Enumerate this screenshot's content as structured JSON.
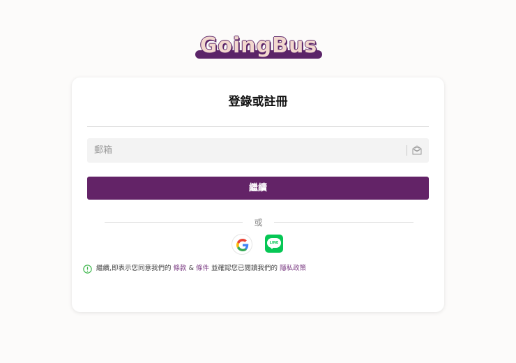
{
  "brand": {
    "logo_text": "GoingBus",
    "accent_color": "#632367",
    "logo_fill": "#f2d8ce"
  },
  "auth": {
    "title": "登錄或註冊",
    "email_placeholder": "郵箱",
    "continue_label": "繼續",
    "or_label": "或",
    "social": [
      {
        "name": "google",
        "icon": "google-icon"
      },
      {
        "name": "line",
        "icon": "line-icon",
        "text": "LINE",
        "color": "#06c755"
      }
    ]
  },
  "terms": {
    "prefix": "繼續,即表示您同意我們的 ",
    "terms_link": "條款",
    "amp": " & ",
    "conditions_link": "條件",
    "middle": " 並確認您已閱讀我們的 ",
    "privacy_link": "隱私政策",
    "icon_color": "#3bb54a"
  }
}
